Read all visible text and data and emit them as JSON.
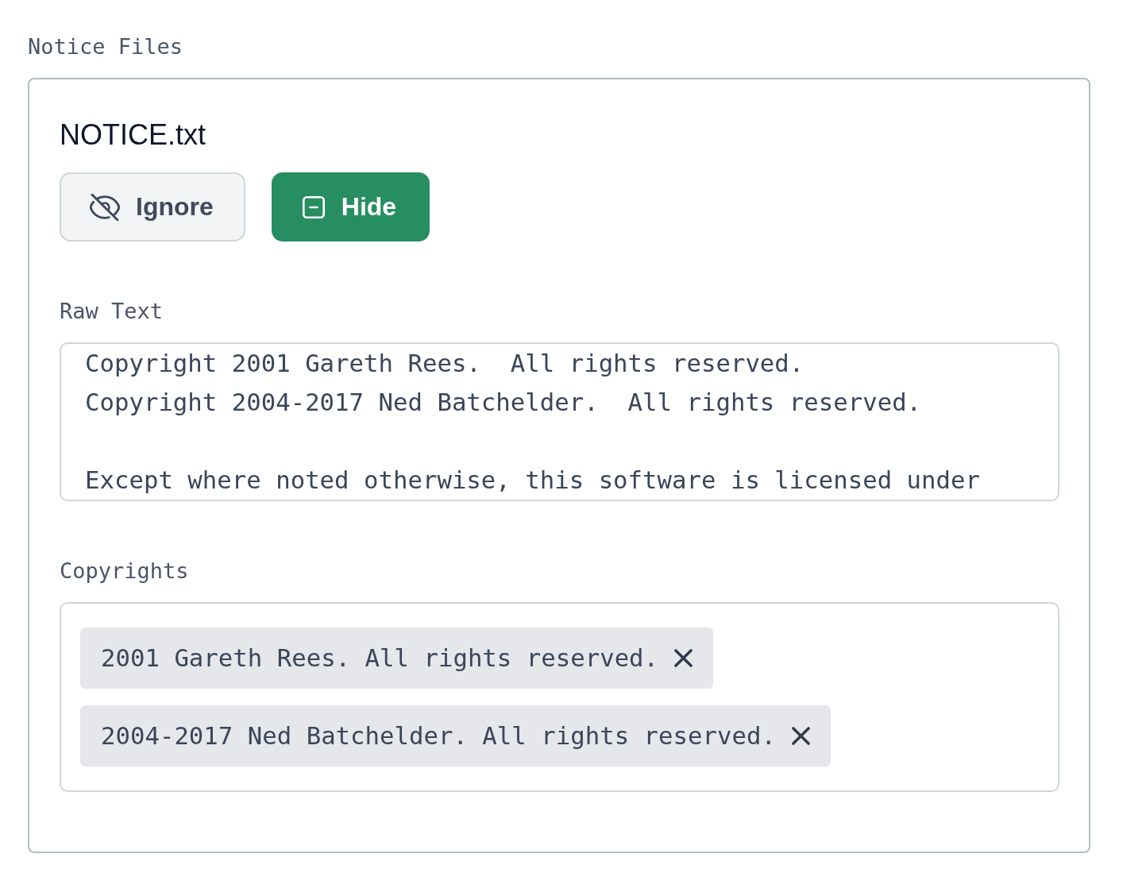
{
  "section": {
    "label": "Notice Files"
  },
  "file": {
    "name": "NOTICE.txt",
    "buttons": [
      {
        "label": "Ignore",
        "kind": "ignore"
      },
      {
        "label": "Hide",
        "kind": "hide"
      }
    ]
  },
  "raw_text": {
    "label": "Raw Text",
    "value": "Copyright 2001 Gareth Rees.  All rights reserved.\nCopyright 2004-2017 Ned Batchelder.  All rights reserved.\n\nExcept where noted otherwise, this software is licensed under"
  },
  "copyrights": {
    "label": "Copyrights",
    "tags": [
      "2001 Gareth Rees. All rights reserved.",
      "2004-2017 Ned Batchelder. All rights reserved."
    ]
  }
}
